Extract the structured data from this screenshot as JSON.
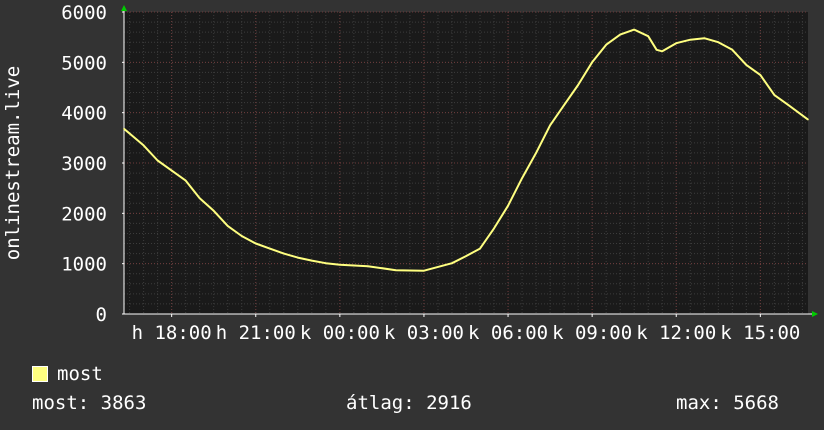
{
  "chart_data": {
    "type": "line",
    "title": "",
    "xlabel": "",
    "ylabel": "onlinestream.live",
    "ylim": [
      0,
      6000
    ],
    "yticks": [
      0,
      1000,
      2000,
      3000,
      4000,
      5000,
      6000
    ],
    "ytick_labels": [
      "0",
      "1000",
      "2000",
      "3000",
      "4000",
      "5000",
      "6000"
    ],
    "xlim": [
      16.3,
      40.7
    ],
    "xticks": [
      18,
      21,
      24,
      27,
      30,
      33,
      36,
      39
    ],
    "xtick_labels": [
      "h 18:00",
      "h 21:00",
      "k 00:00",
      "k 03:00",
      "k 06:00",
      "k 09:00",
      "k 12:00",
      "k 15:00"
    ],
    "grid": true,
    "legend_position": "bottom-left",
    "colors": {
      "background": "#333333",
      "plot_background": "#1a1a1a",
      "major_grid": "#6e3b3b",
      "minor_grid": "#3c3c3c",
      "line": "#ffff80",
      "arrow": "#00cc00"
    },
    "series": [
      {
        "name": "most",
        "color": "#ffff80",
        "x": [
          16.3,
          17.0,
          17.5,
          18.0,
          18.5,
          19.0,
          19.5,
          20.0,
          20.5,
          21.0,
          21.5,
          22.0,
          22.5,
          23.0,
          23.5,
          24.0,
          25.0,
          26.0,
          27.0,
          28.0,
          28.5,
          29.0,
          29.5,
          30.0,
          30.5,
          31.0,
          31.5,
          32.0,
          32.5,
          33.0,
          33.5,
          34.0,
          34.5,
          35.0,
          35.3,
          35.5,
          36.0,
          36.5,
          37.0,
          37.5,
          38.0,
          38.5,
          39.0,
          39.5,
          40.0,
          40.7
        ],
        "values": [
          3680,
          3350,
          3050,
          2850,
          2650,
          2300,
          2050,
          1750,
          1550,
          1400,
          1300,
          1200,
          1120,
          1060,
          1010,
          980,
          950,
          870,
          860,
          1010,
          1150,
          1300,
          1700,
          2150,
          2700,
          3200,
          3750,
          4150,
          4550,
          5000,
          5350,
          5550,
          5650,
          5520,
          5250,
          5220,
          5380,
          5450,
          5480,
          5400,
          5250,
          4950,
          4750,
          4350,
          4150,
          3863
        ]
      }
    ]
  },
  "legend": {
    "label": "most"
  },
  "stats": {
    "current": "most: 3863",
    "average": "átlag: 2916",
    "max": "max: 5668"
  }
}
